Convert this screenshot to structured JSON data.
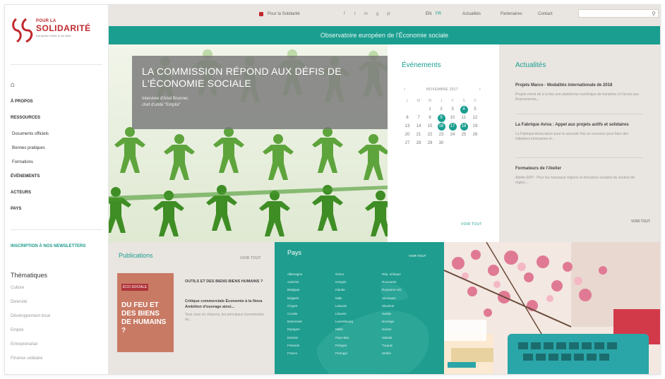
{
  "logo": {
    "line1": "POUR LA",
    "line2": "SOLIDARITÉ",
    "line3": "European think & do tank"
  },
  "topbar": {
    "donate": "Pour la Solidarité",
    "social": [
      "f",
      "t",
      "in",
      "g",
      "yt"
    ],
    "lang_en": "EN",
    "lang_fr": "FR",
    "links": [
      "Actualités",
      "Partenaires",
      "Contact"
    ],
    "search_placeholder": ""
  },
  "banner": {
    "text": "Observatoire européen de l'Économie sociale"
  },
  "sidebar": {
    "home_icon": "home-icon",
    "sections": [
      {
        "label": "À PROPOS",
        "type": "head"
      },
      {
        "label": "RESSOURCES",
        "type": "head"
      },
      {
        "label": "Documents officiels",
        "type": "sub"
      },
      {
        "label": "Bonnes pratiques",
        "type": "sub"
      },
      {
        "label": "Formations",
        "type": "sub"
      },
      {
        "label": "ÉVÉNEMENTS",
        "type": "head"
      },
      {
        "label": "ACTEURS",
        "type": "head"
      },
      {
        "label": "PAYS",
        "type": "head"
      }
    ],
    "newsletter": "INSCRIPTION À NOS NEWSLETTERS",
    "themes_title": "Thématiques",
    "themes": [
      "Culture",
      "Diversité",
      "Développement local",
      "Emploi",
      "Entreprenariat",
      "Finance solidaire"
    ]
  },
  "hero": {
    "title": "LA COMMISSION RÉPOND AUX DÉFIS DE L'ÉCONOMIE SOCIALE",
    "subtitle_line1": "Interview d'Ariel Brunner,",
    "subtitle_line2": "chef d'unité \"Emploi\""
  },
  "events": {
    "title": "Événements",
    "month": "NOVEMBRE 2017",
    "prev": "‹",
    "next": "›",
    "day_names": [
      "L",
      "M",
      "M",
      "J",
      "V",
      "S",
      "D"
    ],
    "weeks": [
      [
        "",
        "",
        "1",
        "2",
        "3",
        "4",
        "5"
      ],
      [
        "6",
        "7",
        "8",
        "9",
        "10",
        "11",
        "12"
      ],
      [
        "13",
        "14",
        "15",
        "16",
        "17",
        "18",
        "19"
      ],
      [
        "20",
        "21",
        "22",
        "23",
        "24",
        "25",
        "26"
      ],
      [
        "27",
        "28",
        "29",
        "30",
        "",
        "",
        ""
      ]
    ],
    "highlighted": [
      "4",
      "9",
      "16",
      "17",
      "18"
    ],
    "more": "VOIR TOUT"
  },
  "news": {
    "title": "Actualités",
    "items": [
      {
        "title": "Projets Marco - Modalités internationale de 2018",
        "desc": "Projets mené de à la fois une plateforme numérique de transition et l'accès aux financements..."
      },
      {
        "title": "La Fabrique Aviva : Appel aux projets actifs et solidaires",
        "desc": "La Fabrique Aviva lance pour la seconde fois un concours pour faire des initiatives innovantes et..."
      },
      {
        "title": "Formateurs de l'Atelier",
        "desc": "Atelier ERP - Pour les nouveaux régions et domaines sociales du secteur de région..."
      }
    ],
    "more": "VOIR TOUT"
  },
  "publications": {
    "title": "Publications",
    "more": "VOIR TOUT",
    "book_label": "ÉCO SOCIALE",
    "book_title": "DU FEU ET DES BIENS DE HUMAINS ?",
    "items": [
      {
        "title": "OUTILS ET DES BIENS BIENS HUMAINS ?",
        "desc": ""
      },
      {
        "title": "Critique commerciale Économie à la Nova Ambition d'ouvrage ainsi...",
        "desc": "Tous ceux en citoyens, les principaux économistes du..."
      }
    ]
  },
  "pays": {
    "title": "Pays",
    "more": "VOIR TOUT",
    "col1": [
      "Allemagne",
      "Autriche",
      "Belgique",
      "Bulgarie",
      "Chypre",
      "Croatie",
      "Danemark",
      "Espagne",
      "Estonie",
      "Finlande",
      "France"
    ],
    "col2": [
      "Grèce",
      "Hongrie",
      "Irlande",
      "Italie",
      "Lettonie",
      "Lituanie",
      "Luxembourg",
      "Malte",
      "Pays-Bas",
      "Pologne",
      "Portugal"
    ],
    "col3": [
      "Rép. tchèque",
      "Roumanie",
      "Royaume-Uni",
      "Slovaquie",
      "Slovénie",
      "Suède",
      "Norvège",
      "Suisse",
      "Islande",
      "Turquie",
      "Serbie"
    ]
  }
}
